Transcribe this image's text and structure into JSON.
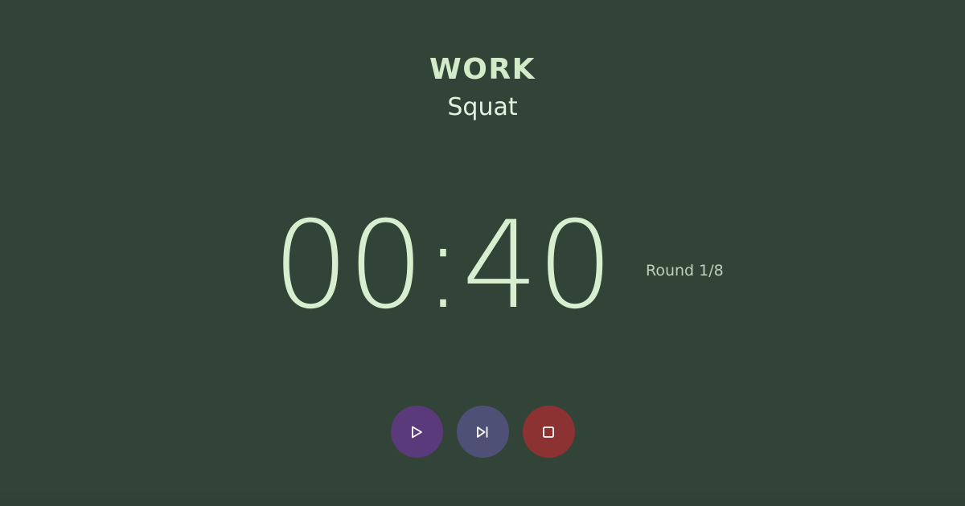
{
  "phase": {
    "label": "WORK",
    "exercise": "Squat"
  },
  "timer": {
    "display": "00:40"
  },
  "round": {
    "text": "Round 1/8"
  },
  "controls": {
    "play_icon": "play-icon",
    "skip_icon": "skip-next-icon",
    "stop_icon": "stop-icon"
  },
  "colors": {
    "background": "#324437",
    "text": "#d6ecd0",
    "play_button": "#5b3a7c",
    "skip_button": "#4f5076",
    "stop_button": "#8c3232"
  }
}
